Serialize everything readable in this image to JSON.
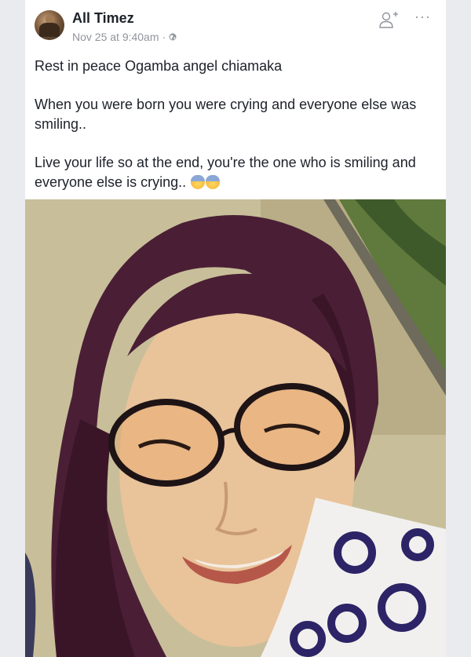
{
  "post": {
    "author": "All Timez",
    "timestamp": "Nov 25 at 9:40am",
    "separator": "·",
    "privacy_icon": "globe-icon",
    "header_icons": [
      "follow-icon",
      "more-options-icon"
    ],
    "more_label": "···",
    "paragraphs": [
      "Rest in peace Ogamba angel chiamaka",
      "When you were born you were crying and everyone else was smiling..",
      "Live your life so at the end, you're the one who is smiling and everyone else is crying.."
    ],
    "trailing_emoji": [
      "fearful-face-emoji",
      "fearful-face-emoji"
    ]
  },
  "colors": {
    "text": "#1d2129",
    "meta": "#90949c",
    "card_bg": "#ffffff",
    "page_bg": "#e9ebee"
  }
}
